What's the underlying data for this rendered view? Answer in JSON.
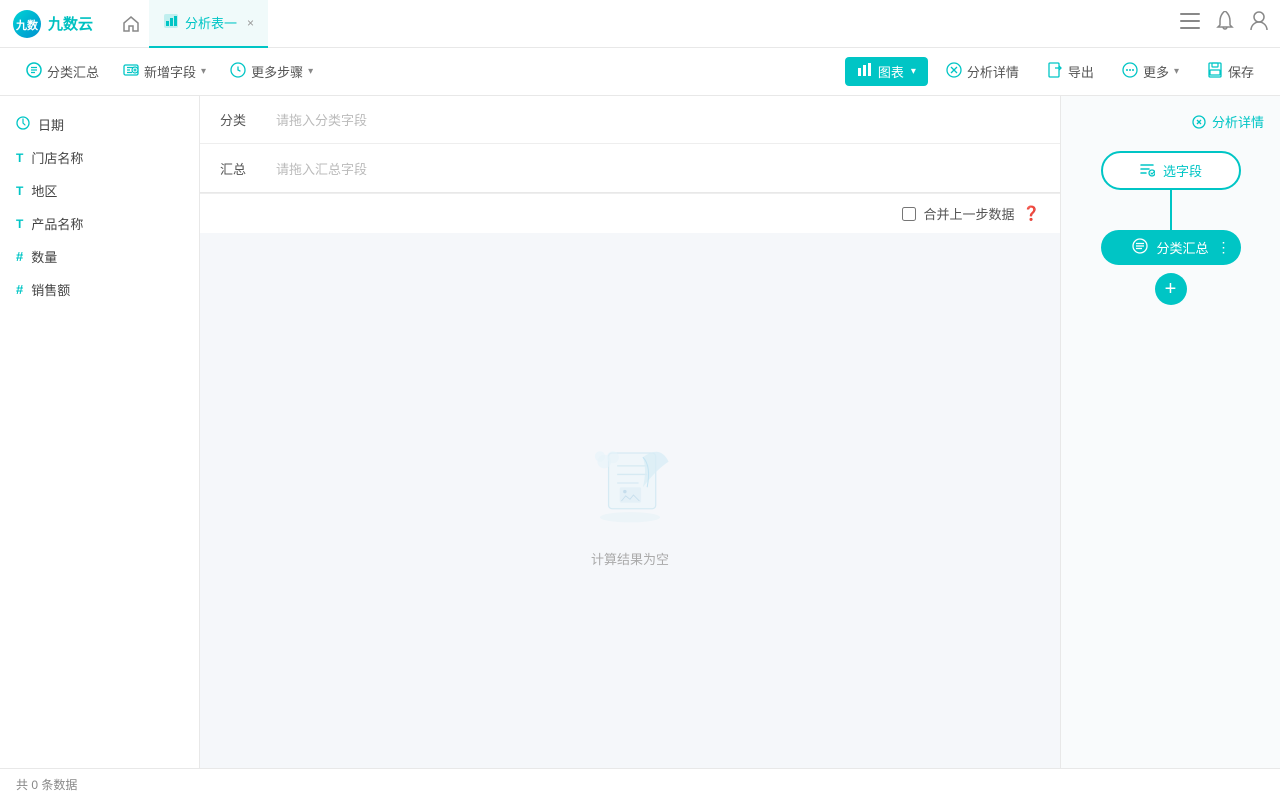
{
  "app": {
    "logo_text": "九数云",
    "logo_icon": "☁"
  },
  "nav": {
    "home_icon": "⌂",
    "tab": {
      "icon": "📊",
      "label": "分析表一",
      "close_icon": "×"
    },
    "right_icons": [
      "≡",
      "🔔",
      "👤"
    ]
  },
  "toolbar": {
    "classify_summary": "分类汇总",
    "add_field": "新增字段",
    "more_steps": "更多步骤",
    "chart_btn": "图表",
    "analysis_detail": "分析详情",
    "export": "导出",
    "more": "更多",
    "save": "保存"
  },
  "fields": [
    {
      "type": "date",
      "label": "日期",
      "icon": "◎"
    },
    {
      "type": "text",
      "label": "门店名称",
      "icon": "T"
    },
    {
      "type": "text",
      "label": "地区",
      "icon": "T"
    },
    {
      "type": "text",
      "label": "产品名称",
      "icon": "T"
    },
    {
      "type": "number",
      "label": "数量",
      "icon": "#"
    },
    {
      "type": "number",
      "label": "销售额",
      "icon": "#"
    }
  ],
  "dropzones": {
    "classify_label": "分类",
    "classify_placeholder": "请拖入分类字段",
    "summary_label": "汇总",
    "summary_placeholder": "请拖入汇总字段"
  },
  "empty_state": {
    "text": "计算结果为空"
  },
  "merge": {
    "label": "合并上一步数据"
  },
  "right_panel": {
    "analysis_detail": "分析详情",
    "select_field": "选字段",
    "classify_summary": "分类汇总",
    "add_step": "+"
  },
  "bottom_bar": {
    "count_prefix": "共",
    "count": "0",
    "count_suffix": "条数据"
  }
}
